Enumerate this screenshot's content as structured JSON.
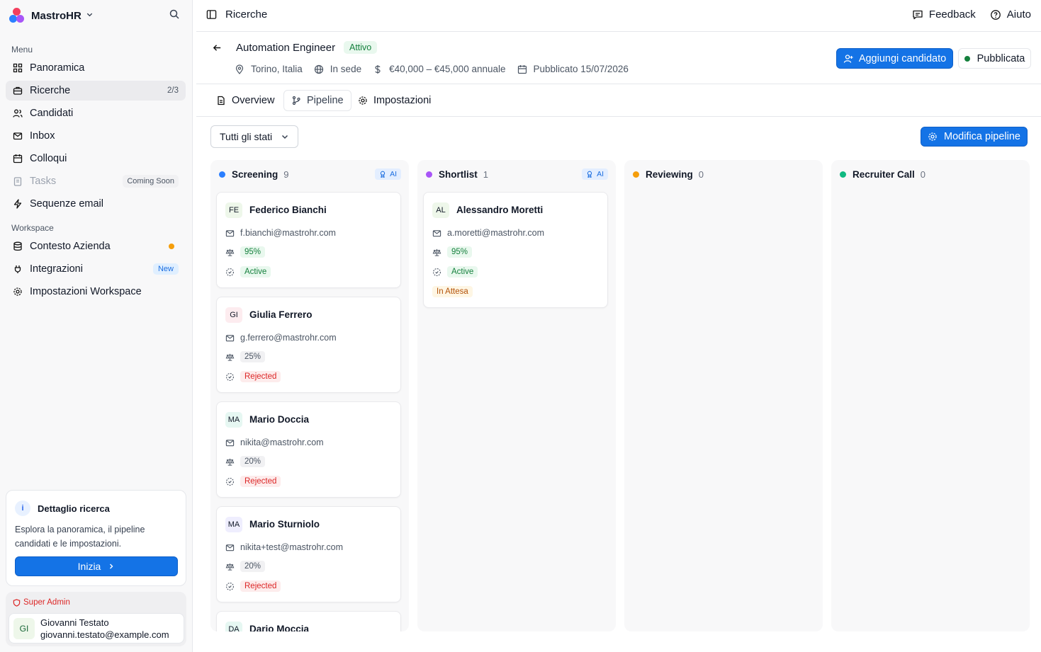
{
  "brand": {
    "name": "MastroHR"
  },
  "sidebar": {
    "menu_label": "Menu",
    "workspace_label": "Workspace",
    "items": [
      {
        "label": "Panoramica"
      },
      {
        "label": "Ricerche",
        "count": "2/3"
      },
      {
        "label": "Candidati"
      },
      {
        "label": "Inbox"
      },
      {
        "label": "Colloqui"
      },
      {
        "label": "Tasks",
        "badge": "Coming Soon"
      },
      {
        "label": "Sequenze email"
      }
    ],
    "workspace_items": [
      {
        "label": "Contesto Azienda"
      },
      {
        "label": "Integrazioni",
        "badge": "New"
      },
      {
        "label": "Impostazioni Workspace"
      }
    ],
    "help_card": {
      "title": "Dettaglio ricerca",
      "text": "Esplora la panoramica, il pipeline candidati e le impostazioni.",
      "button": "Inizia"
    },
    "user": {
      "role": "Super Admin",
      "initials": "GI",
      "name": "Giovanni Testato",
      "email": "giovanni.testato@example.com"
    }
  },
  "topbar": {
    "title": "Ricerche",
    "feedback": "Feedback",
    "help": "Aiuto"
  },
  "job": {
    "title": "Automation Engineer",
    "status": "Attivo",
    "location": "Torino, Italia",
    "work_mode": "In sede",
    "salary": "€40,000 – €45,000 annuale",
    "published": "Pubblicato 15/07/2026",
    "add_button": "Aggiungi candidato",
    "published_button": "Pubblicata"
  },
  "tabs": [
    {
      "label": "Overview"
    },
    {
      "label": "Pipeline"
    },
    {
      "label": "Impostazioni"
    }
  ],
  "filter": {
    "label": "Tutti gli stati"
  },
  "edit_pipeline": "Modifica pipeline",
  "ai_label": "AI",
  "colors": {
    "accent": "#1473e6",
    "screening": "#2b7fff",
    "shortlist": "#a855f7",
    "reviewing": "#f59e0b",
    "recruiter_call": "#10b981"
  },
  "columns": [
    {
      "name": "Screening",
      "count": "9",
      "cards": [
        {
          "initials": "FE",
          "name": "Federico Bianchi",
          "email": "f.bianchi@mastrohr.com",
          "score": "95%",
          "status": "Active"
        },
        {
          "initials": "GI",
          "name": "Giulia Ferrero",
          "email": "g.ferrero@mastrohr.com",
          "score": "25%",
          "status": "Rejected"
        },
        {
          "initials": "MA",
          "name": "Mario Doccia",
          "email": "nikita@mastrohr.com",
          "score": "20%",
          "status": "Rejected"
        },
        {
          "initials": "MA",
          "name": "Mario Sturniolo",
          "email": "nikita+test@mastrohr.com",
          "score": "20%",
          "status": "Rejected"
        },
        {
          "initials": "DA",
          "name": "Dario Moccia"
        }
      ]
    },
    {
      "name": "Shortlist",
      "count": "1",
      "cards": [
        {
          "initials": "AL",
          "name": "Alessandro Moretti",
          "email": "a.moretti@mastrohr.com",
          "score": "95%",
          "status": "Active",
          "extra": "In Attesa"
        }
      ]
    },
    {
      "name": "Reviewing",
      "count": "0",
      "cards": []
    },
    {
      "name": "Recruiter Call",
      "count": "0",
      "cards": []
    }
  ]
}
